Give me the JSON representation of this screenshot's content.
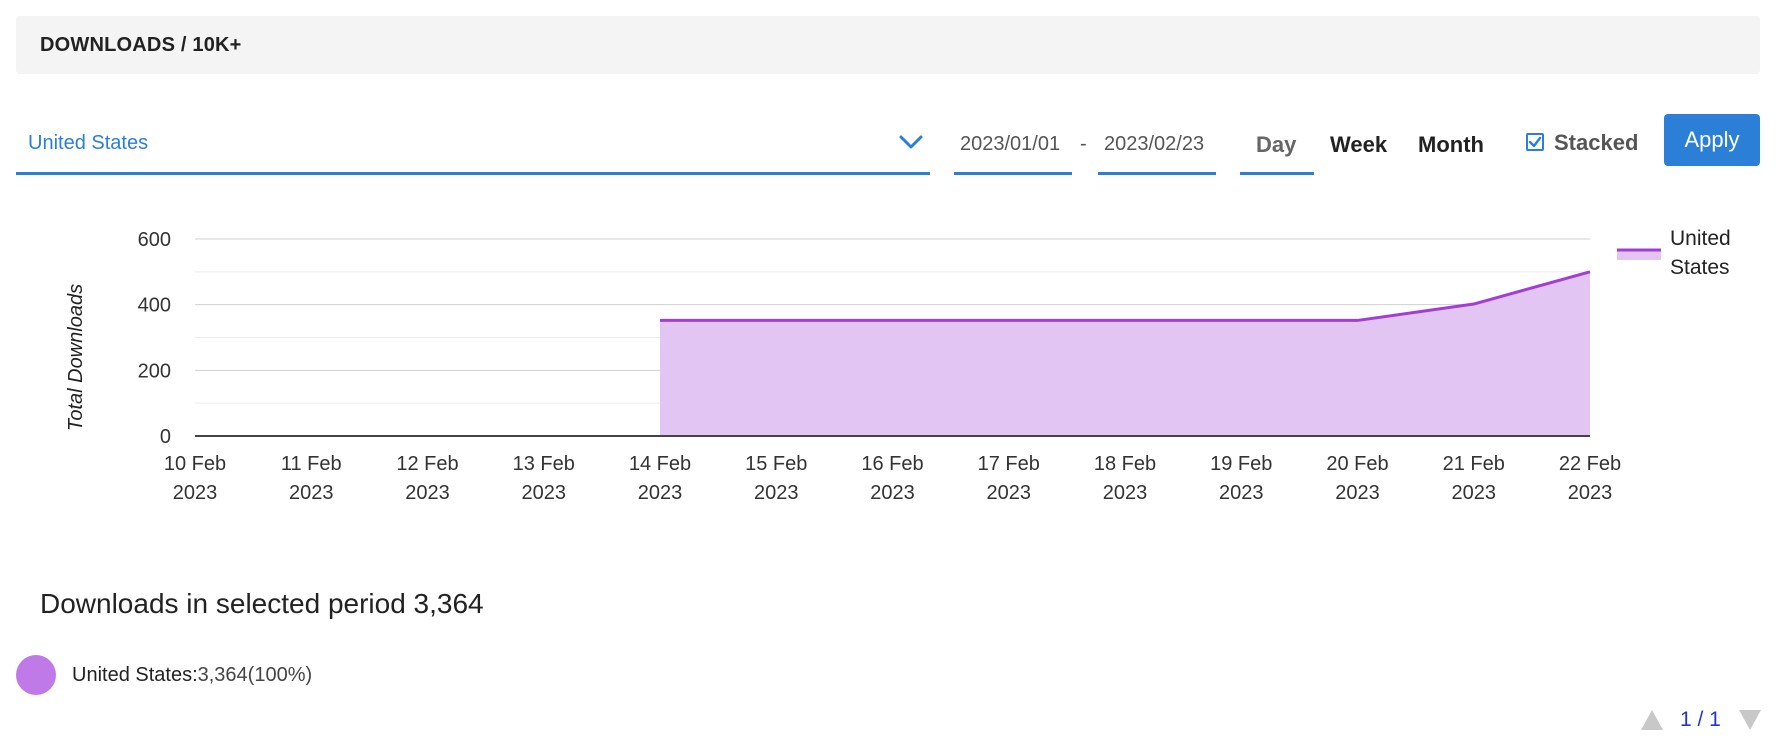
{
  "header": {
    "title": "DOWNLOADS / 10K+"
  },
  "filters": {
    "country": "United States",
    "date_from": "2023/01/01",
    "date_separator": "-",
    "date_to": "2023/02/23",
    "periods": [
      "Day",
      "Week",
      "Month"
    ],
    "selected_period": "Day",
    "stacked_label": "Stacked",
    "stacked_checked": true,
    "apply_label": "Apply"
  },
  "colors": {
    "accent": "#2b7fd6",
    "series_line": "#a23ed8",
    "series_fill": "#e2c5f2",
    "legend_dot": "#c07ae8"
  },
  "chart_data": {
    "type": "area",
    "stacked": true,
    "ylabel": "Total Downloads",
    "ylim": [
      0,
      600
    ],
    "yticks": [
      0,
      200,
      400,
      600
    ],
    "grid": true,
    "legend_position": "right",
    "categories": [
      "10 Feb 2023",
      "11 Feb 2023",
      "12 Feb 2023",
      "13 Feb 2023",
      "14 Feb 2023",
      "15 Feb 2023",
      "16 Feb 2023",
      "17 Feb 2023",
      "18 Feb 2023",
      "19 Feb 2023",
      "20 Feb 2023",
      "21 Feb 2023",
      "22 Feb 2023"
    ],
    "series": [
      {
        "name": "United States",
        "values": [
          null,
          null,
          null,
          null,
          352,
          352,
          352,
          352,
          352,
          352,
          352,
          402,
          500
        ]
      }
    ]
  },
  "summary": {
    "text": "Downloads in selected period 3,364",
    "items": [
      {
        "label": "United States:",
        "value": "3,364(100%)"
      }
    ]
  },
  "pager": {
    "text": "1 / 1"
  }
}
